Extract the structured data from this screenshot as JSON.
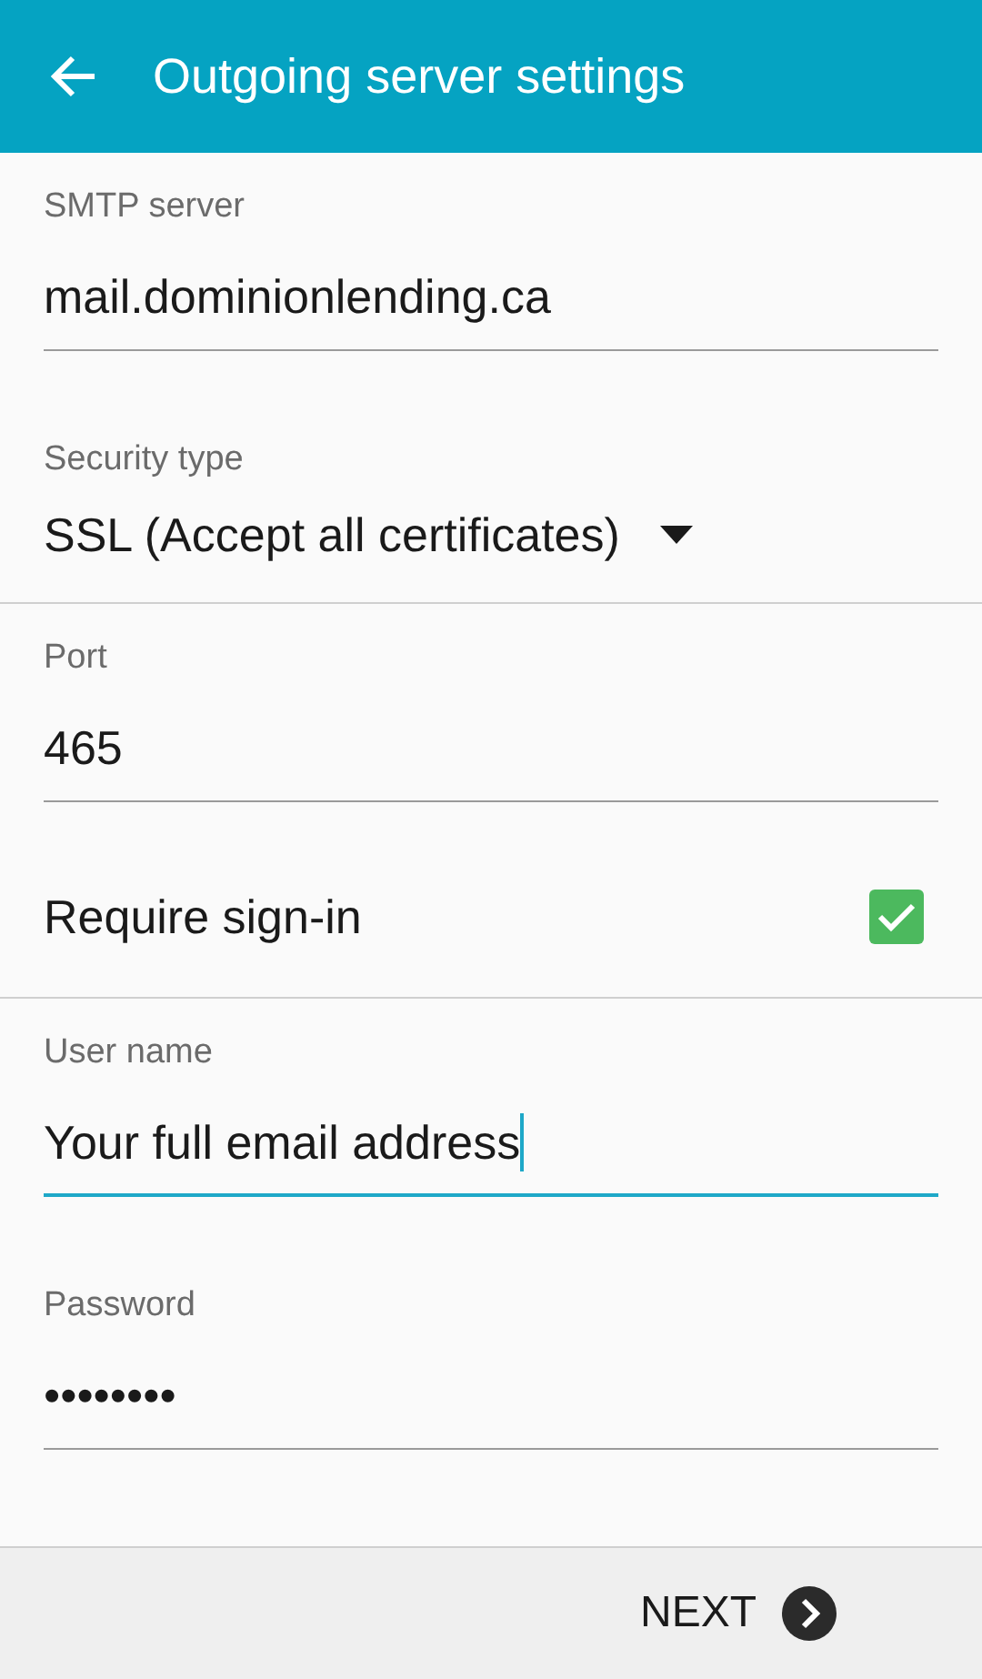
{
  "header": {
    "title": "Outgoing server settings"
  },
  "fields": [
    {
      "kind": "text",
      "label": "SMTP server",
      "value": "mail.dominionlending.ca",
      "focused": false
    },
    {
      "kind": "dropdown",
      "label": "Security type",
      "value": "SSL (Accept all certificates)"
    },
    {
      "kind": "text",
      "label": "Port",
      "value": "465",
      "focused": false
    },
    {
      "kind": "checkbox",
      "label": "Require sign-in",
      "checked": true
    },
    {
      "kind": "text",
      "label": "User name",
      "value": "Your full email address",
      "focused": true
    },
    {
      "kind": "text",
      "label": "Password",
      "value": "••••••••",
      "focused": false
    }
  ],
  "footer": {
    "next": "NEXT"
  }
}
